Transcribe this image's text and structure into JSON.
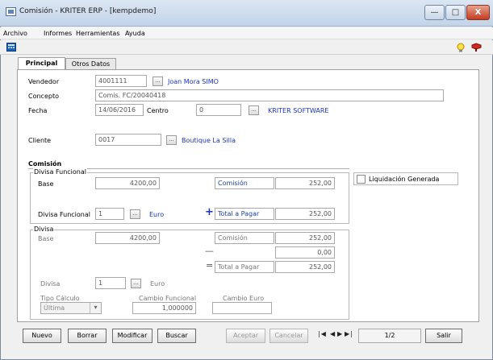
{
  "window": {
    "title": "Comisión - KRITER ERP - [kempdemo]",
    "min_glyph": "—",
    "max_glyph": "□",
    "close_glyph": "X"
  },
  "menu": [
    "Archivo",
    "Informes",
    "Herramientas",
    "Ayuda"
  ],
  "tabs": [
    "Principal",
    "Otros Datos"
  ],
  "form": {
    "vendedor": {
      "label": "Vendedor",
      "code": "4001111",
      "name": "Joan Mora SIMO"
    },
    "concepto": {
      "label": "Concepto",
      "value": "Comis. FC/20040418"
    },
    "fecha": {
      "label": "Fecha",
      "value": "14/06/2016"
    },
    "centro": {
      "label": "Centro",
      "code": "0",
      "name": "KRITER SOFTWARE"
    },
    "cliente": {
      "label": "Cliente",
      "code": "0017",
      "name": "Boutique La Silla"
    },
    "lookup_glyph": "...",
    "comision_title": "Comisión",
    "funcional": {
      "title": "Divisa Funcional",
      "base_label": "Base",
      "base_value": "4200,00",
      "comision_label": "Comisión",
      "comision_value": "252,00",
      "divisa_label": "Divisa Funcional",
      "divisa_code": "1",
      "divisa_name": "Euro",
      "plus": "+",
      "total_label": "Total a Pagar",
      "total_value": "252,00"
    },
    "liquidacion_label": "Liquidación Generada",
    "divisa": {
      "title": "Divisa",
      "base_label": "Base",
      "base_value": "4200,00",
      "comision_label": "Comisión",
      "comision_value": "252,00",
      "minus": "—",
      "resta_value": "0,00",
      "equals": "=",
      "total_label": "Total a Pagar",
      "total_value": "252,00",
      "divisa_label": "Divisa",
      "divisa_code": "1",
      "divisa_name": "Euro",
      "tipo_label": "Tipo Cálculo",
      "tipo_value": "Última",
      "dropdown_glyph": "▾",
      "cambio_funcional_label": "Cambio Funcional",
      "cambio_funcional_value": "1,000000",
      "cambio_euro_label": "Cambio Euro",
      "cambio_euro_value": ""
    }
  },
  "buttons": {
    "nuevo": "Nuevo",
    "borrar": "Borrar",
    "modificar": "Modificar",
    "buscar": "Buscar",
    "aceptar": "Aceptar",
    "cancelar": "Cancelar",
    "nav_first": "|◀",
    "nav_prev": "◀",
    "nav_next": "▶",
    "nav_last": "▶|",
    "page": "1/2",
    "salir": "Salir"
  },
  "colors": {
    "link": "#1a33b8",
    "titlebar": "#c3d4e8"
  }
}
